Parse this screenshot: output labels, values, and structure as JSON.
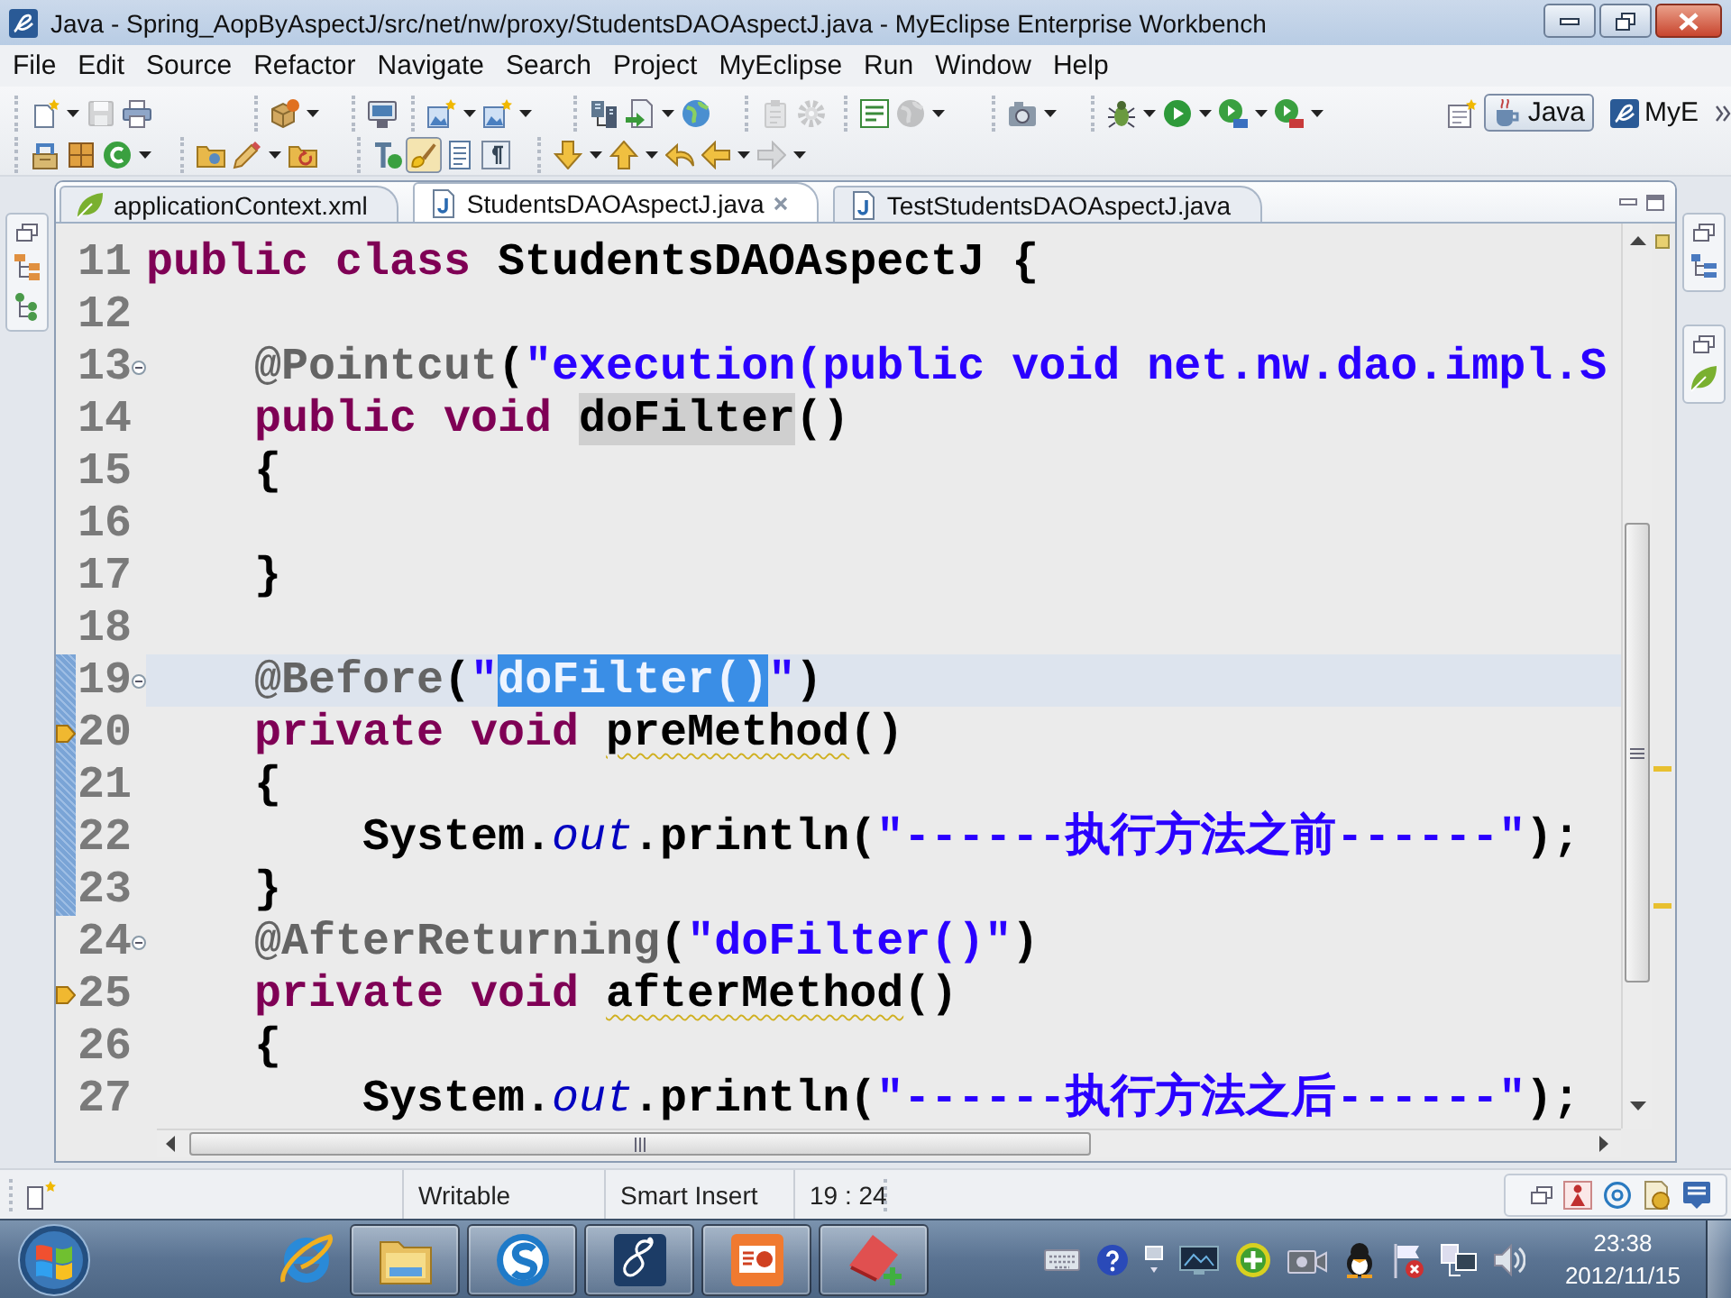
{
  "window": {
    "title": "Java - Spring_AopByAspectJ/src/net/nw/proxy/StudentsDAOAspectJ.java - MyEclipse Enterprise Workbench"
  },
  "menu": [
    "File",
    "Edit",
    "Source",
    "Refactor",
    "Navigate",
    "Search",
    "Project",
    "MyEclipse",
    "Run",
    "Window",
    "Help"
  ],
  "toolbar": {
    "rows": [
      [
        [
          {
            "dropdown": true,
            "disabled": false,
            "pressed": false
          },
          {
            "dropdown": false,
            "disabled": true,
            "pressed": false
          },
          {
            "dropdown": false,
            "disabled": false,
            "pressed": false
          }
        ],
        [
          {
            "dropdown": true,
            "disabled": false,
            "pressed": false
          }
        ],
        [
          {
            "dropdown": false,
            "disabled": false,
            "pressed": false
          }
        ],
        [
          {
            "dropdown": true,
            "disabled": false,
            "pressed": false
          },
          {
            "dropdown": true,
            "disabled": false,
            "pressed": false
          }
        ],
        [
          {
            "dropdown": false,
            "disabled": false,
            "pressed": false
          },
          {
            "dropdown": true,
            "disabled": false,
            "pressed": false
          },
          {
            "dropdown": false,
            "disabled": false,
            "pressed": false
          }
        ],
        [
          {
            "dropdown": false,
            "disabled": true,
            "pressed": false
          },
          {
            "dropdown": false,
            "disabled": true,
            "pressed": false
          }
        ],
        [
          {
            "dropdown": false,
            "disabled": false,
            "pressed": false
          },
          {
            "dropdown": true,
            "disabled": true,
            "pressed": false
          }
        ],
        [
          {
            "dropdown": true,
            "disabled": false,
            "pressed": false
          }
        ],
        [
          {
            "dropdown": true,
            "disabled": false,
            "pressed": false
          },
          {
            "dropdown": true,
            "disabled": false,
            "pressed": false
          },
          {
            "dropdown": true,
            "disabled": false,
            "pressed": false
          },
          {
            "dropdown": true,
            "disabled": false,
            "pressed": false
          }
        ]
      ],
      [
        [
          {
            "dropdown": false,
            "disabled": false,
            "pressed": false
          },
          {
            "dropdown": false,
            "disabled": false,
            "pressed": false
          },
          {
            "dropdown": true,
            "disabled": false,
            "pressed": false
          }
        ],
        [
          {
            "dropdown": false,
            "disabled": false,
            "pressed": false
          },
          {
            "dropdown": true,
            "disabled": false,
            "pressed": false
          },
          {
            "dropdown": false,
            "disabled": false,
            "pressed": false
          }
        ],
        [
          {
            "dropdown": false,
            "disabled": false,
            "pressed": false
          },
          {
            "dropdown": false,
            "disabled": false,
            "pressed": true
          },
          {
            "dropdown": false,
            "disabled": false,
            "pressed": false
          },
          {
            "dropdown": false,
            "disabled": false,
            "pressed": false
          }
        ],
        [
          {
            "dropdown": true,
            "disabled": false,
            "pressed": false
          },
          {
            "dropdown": true,
            "disabled": false,
            "pressed": false
          },
          {
            "dropdown": false,
            "disabled": false,
            "pressed": false
          },
          {
            "dropdown": true,
            "disabled": false,
            "pressed": false
          },
          {
            "dropdown": true,
            "disabled": true,
            "pressed": false
          }
        ]
      ]
    ]
  },
  "perspectives": [
    {
      "label": "Java",
      "selected": true
    },
    {
      "label": "MyE",
      "selected": false
    }
  ],
  "editor": {
    "tabs": [
      {
        "label": "applicationContext.xml",
        "kind": "xml",
        "selected": false
      },
      {
        "label": "StudentsDAOAspectJ.java",
        "kind": "java",
        "selected": true
      },
      {
        "label": "TestStudentsDAOAspectJ.java",
        "kind": "java",
        "selected": false
      }
    ],
    "lines": [
      {
        "number": "11",
        "current": false,
        "in_range": false,
        "foldable": false,
        "marker": false,
        "tokens": [
          {
            "kind": "keyword",
            "text": "public"
          },
          {
            "kind": "keyword",
            "text": " class"
          },
          {
            "kind": "plain",
            "text": " StudentsDAOAspectJ {"
          }
        ]
      },
      {
        "number": "12",
        "current": false,
        "in_range": false,
        "foldable": false,
        "marker": false
      },
      {
        "number": "13",
        "current": false,
        "in_range": false,
        "foldable": true,
        "marker": false,
        "tokens": [
          {
            "kind": "annotation",
            "text": "    @Pointcut"
          },
          {
            "kind": "plain",
            "text": "("
          },
          {
            "kind": "string",
            "text": "\"execution(public void net.nw.dao.impl.S"
          }
        ]
      },
      {
        "number": "14",
        "current": false,
        "in_range": false,
        "foldable": false,
        "marker": false,
        "tokens": [
          {
            "kind": "keyword",
            "text": "    public"
          },
          {
            "kind": "keyword",
            "text": " void "
          },
          {
            "kind": "plain",
            "text": "doFilter",
            "occurrence": true
          },
          {
            "kind": "plain",
            "text": "()"
          }
        ]
      },
      {
        "number": "15",
        "current": false,
        "in_range": false,
        "foldable": false,
        "marker": false,
        "tokens": [
          {
            "kind": "plain",
            "text": "    {"
          }
        ]
      },
      {
        "number": "16",
        "current": false,
        "in_range": false,
        "foldable": false,
        "marker": false
      },
      {
        "number": "17",
        "current": false,
        "in_range": false,
        "foldable": false,
        "marker": false,
        "tokens": [
          {
            "kind": "plain",
            "text": "    }"
          }
        ]
      },
      {
        "number": "18",
        "current": false,
        "in_range": false,
        "foldable": false,
        "marker": false
      },
      {
        "number": "19",
        "current": true,
        "in_range": true,
        "foldable": true,
        "marker": false,
        "tokens": [
          {
            "kind": "annotation",
            "text": "    @Before"
          },
          {
            "kind": "plain",
            "text": "("
          },
          {
            "kind": "string",
            "text": "\""
          },
          {
            "kind": "string",
            "text": "doFilter()",
            "selected": true
          },
          {
            "kind": "string",
            "text": "\""
          },
          {
            "kind": "plain",
            "text": ")"
          }
        ]
      },
      {
        "number": "20",
        "current": false,
        "in_range": true,
        "foldable": false,
        "marker": true,
        "tokens": [
          {
            "kind": "keyword",
            "text": "    private"
          },
          {
            "kind": "keyword",
            "text": " void "
          },
          {
            "kind": "plain",
            "text": "preMethod",
            "warning": true
          },
          {
            "kind": "plain",
            "text": "()"
          }
        ]
      },
      {
        "number": "21",
        "current": false,
        "in_range": true,
        "foldable": false,
        "marker": false,
        "tokens": [
          {
            "kind": "plain",
            "text": "    {"
          }
        ]
      },
      {
        "number": "22",
        "current": false,
        "in_range": true,
        "foldable": false,
        "marker": false,
        "tokens": [
          {
            "kind": "plain",
            "text": "        System."
          },
          {
            "kind": "field",
            "text": "out"
          },
          {
            "kind": "plain",
            "text": ".println("
          },
          {
            "kind": "string",
            "text": "\"------执行方法之前------\""
          },
          {
            "kind": "plain",
            "text": ");"
          }
        ]
      },
      {
        "number": "23",
        "current": false,
        "in_range": true,
        "foldable": false,
        "marker": false,
        "tokens": [
          {
            "kind": "plain",
            "text": "    }"
          }
        ]
      },
      {
        "number": "24",
        "current": false,
        "in_range": false,
        "foldable": true,
        "marker": false,
        "tokens": [
          {
            "kind": "annotation",
            "text": "    @AfterReturning"
          },
          {
            "kind": "plain",
            "text": "("
          },
          {
            "kind": "string",
            "text": "\"doFilter()\""
          },
          {
            "kind": "plain",
            "text": ")"
          }
        ]
      },
      {
        "number": "25",
        "current": false,
        "in_range": false,
        "foldable": false,
        "marker": true,
        "tokens": [
          {
            "kind": "keyword",
            "text": "    private"
          },
          {
            "kind": "keyword",
            "text": " void "
          },
          {
            "kind": "plain",
            "text": "afterMethod",
            "warning": true
          },
          {
            "kind": "plain",
            "text": "()"
          }
        ]
      },
      {
        "number": "26",
        "current": false,
        "in_range": false,
        "foldable": false,
        "marker": false,
        "tokens": [
          {
            "kind": "plain",
            "text": "    {"
          }
        ]
      },
      {
        "number": "27",
        "current": false,
        "in_range": false,
        "foldable": false,
        "marker": false,
        "tokens": [
          {
            "kind": "plain",
            "text": "        System."
          },
          {
            "kind": "field",
            "text": "out"
          },
          {
            "kind": "plain",
            "text": ".println("
          },
          {
            "kind": "string",
            "text": "\"------执行方法之后------\""
          },
          {
            "kind": "plain",
            "text": ");"
          }
        ]
      }
    ]
  },
  "status_bar": {
    "fields": [
      "Writable",
      "Smart Insert",
      "19 : 24"
    ]
  },
  "taskbar": {
    "apps": [
      {
        "running": false
      },
      {
        "running": true
      },
      {
        "running": true
      },
      {
        "running": true
      },
      {
        "running": true
      },
      {
        "running": true
      }
    ],
    "clock": {
      "time": "23:38",
      "date": "2012/11/15"
    }
  }
}
